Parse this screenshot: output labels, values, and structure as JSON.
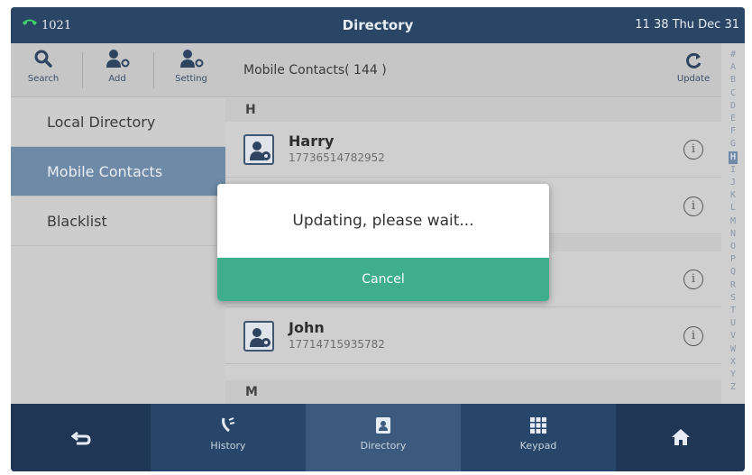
{
  "status": {
    "extension": "1021",
    "title": "Directory",
    "datetime": "11 38 Thu Dec 31"
  },
  "toolbar": {
    "search_label": "Search",
    "add_label": "Add",
    "setting_label": "Setting"
  },
  "sidebar": {
    "items": [
      {
        "label": "Local Directory",
        "active": false
      },
      {
        "label": "Mobile Contacts",
        "active": true
      },
      {
        "label": "Blacklist",
        "active": false
      }
    ]
  },
  "list": {
    "title": "Mobile Contacts( 144 )",
    "update_label": "Update",
    "sections": [
      "H",
      "M"
    ],
    "contacts": [
      {
        "name": "Harry",
        "number": "17736514782952"
      },
      {
        "name": "John",
        "number": "17714715935782"
      }
    ]
  },
  "alphabet": [
    "#",
    "A",
    "B",
    "C",
    "D",
    "E",
    "F",
    "G",
    "H",
    "I",
    "J",
    "K",
    "L",
    "M",
    "N",
    "O",
    "P",
    "Q",
    "R",
    "S",
    "T",
    "U",
    "V",
    "W",
    "X",
    "Y",
    "Z"
  ],
  "alphabet_selected": "H",
  "dialog": {
    "message": "Updating, please wait...",
    "cancel_label": "Cancel"
  },
  "bottom": {
    "history_label": "History",
    "directory_label": "Directory",
    "keypad_label": "Keypad"
  },
  "colors": {
    "accent": "#3fae8d",
    "active_nav": "#6e8aa6",
    "bar": "#1f3654"
  }
}
